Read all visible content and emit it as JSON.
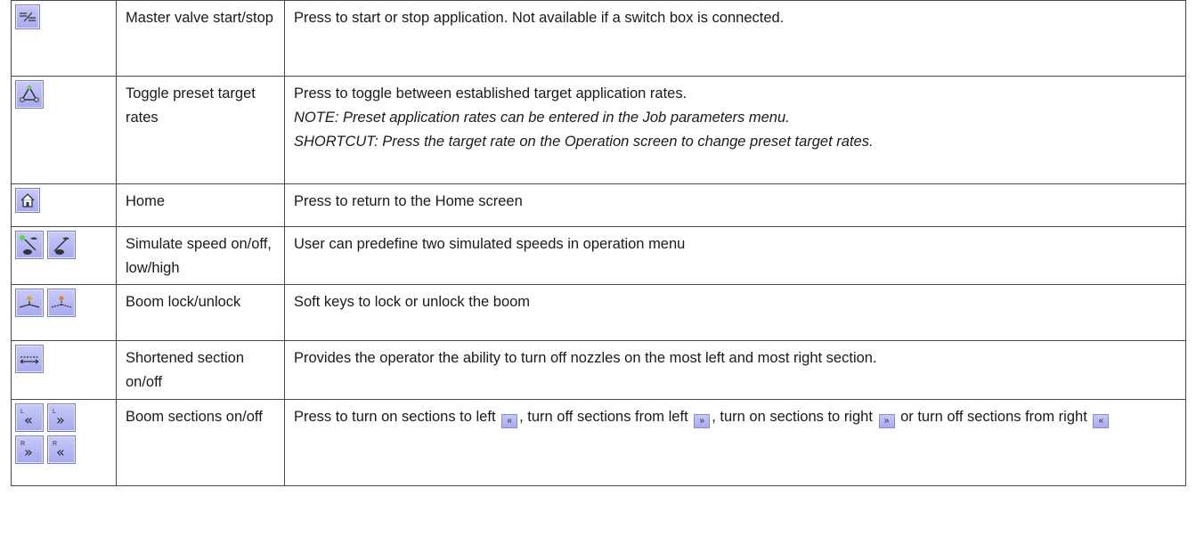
{
  "rows": [
    {
      "name": "Master valve start/stop",
      "desc": [
        "Press to start or stop application. Not available if a switch box is connected."
      ],
      "icons": [
        "master-valve-icon"
      ]
    },
    {
      "name": "Toggle preset target rates",
      "desc": [
        "Press to toggle between established target application rates.",
        "NOTE:  Preset application rates can be entered in the Job parameters menu.",
        "SHORTCUT:  Press the target rate on the Operation screen to change preset target rates."
      ],
      "icons": [
        "preset-rates-icon"
      ]
    },
    {
      "name": "Home",
      "desc": [
        "Press to return to the Home screen"
      ],
      "icons": [
        "home-icon"
      ]
    },
    {
      "name": "Simulate speed on/off, low/high",
      "desc": [
        "User can predefine two simulated speeds in operation menu"
      ],
      "icons": [
        "simulate-speed-low-icon",
        "simulate-speed-high-icon"
      ]
    },
    {
      "name": "Boom lock/unlock",
      "desc": [
        "Soft keys to lock or unlock the boom"
      ],
      "icons": [
        "boom-lock-icon",
        "boom-unlock-icon"
      ]
    },
    {
      "name": "Shortened section on/off",
      "desc": [
        "Provides the operator the ability to turn off nozzles on the most left and most right section."
      ],
      "icons": [
        "shortened-section-icon"
      ]
    },
    {
      "name": "Boom sections on/off",
      "desc_parts": [
        "Press to turn on sections to left ",
        ", turn off sections from left ",
        ", turn on sections to right ",
        " or turn off sections from right "
      ],
      "inline_glyphs": [
        "«",
        "»",
        "»",
        "«"
      ],
      "icons": [
        "left-on-icon",
        "left-off-icon",
        "right-on-icon",
        "right-off-icon"
      ],
      "key_glyphs": [
        "«",
        "»",
        "»",
        "«"
      ],
      "key_marks": [
        "L",
        "L",
        "R",
        "R"
      ]
    }
  ]
}
